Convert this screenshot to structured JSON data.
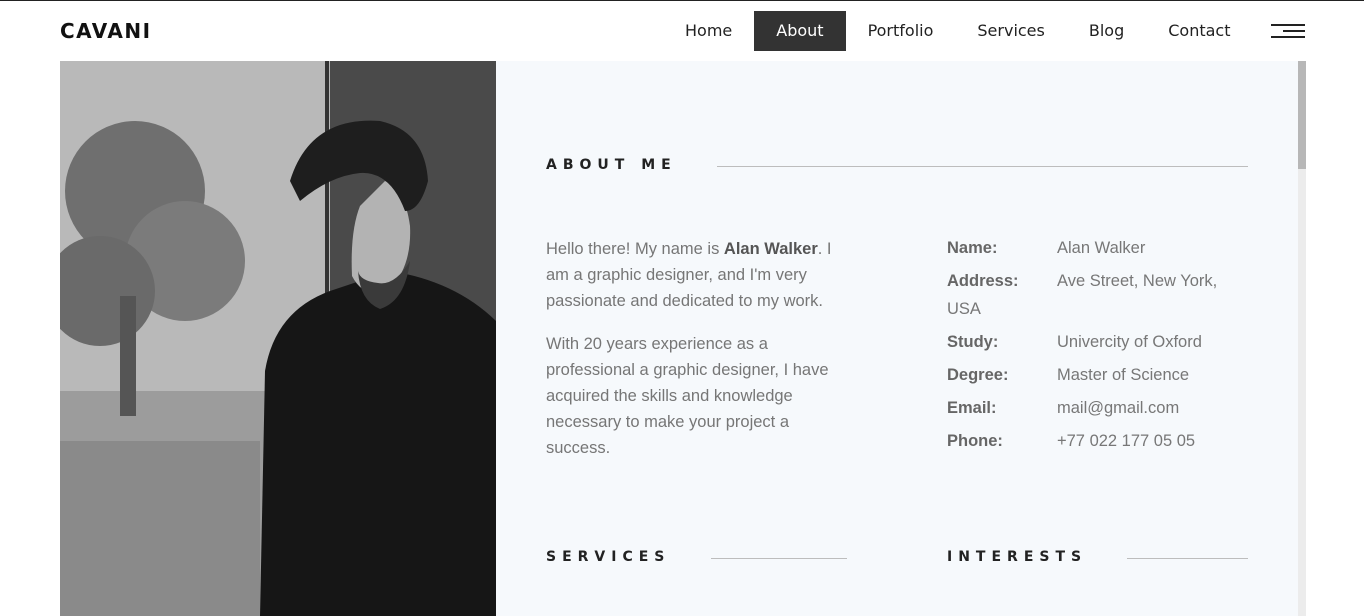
{
  "brand": "CAVANI",
  "nav": [
    "Home",
    "About",
    "Portfolio",
    "Services",
    "Blog",
    "Contact"
  ],
  "nav_active": "About",
  "about": {
    "title": "ABOUT ME",
    "intro_pre": "Hello there! My name is ",
    "intro_name": "Alan Walker",
    "intro_post": ". I am a graphic designer, and I'm very passionate and dedicated to my work.",
    "paragraph2": "With 20 years experience as a professional a graphic designer, I have acquired the skills and knowledge necessary to make your project a success."
  },
  "info": [
    {
      "label": "Name:",
      "value": "Alan Walker"
    },
    {
      "label": "Address:",
      "value": "Ave Street, New York,"
    },
    {
      "label": "",
      "value": "USA"
    },
    {
      "label": "Study:",
      "value": "Univercity of Oxford"
    },
    {
      "label": "Degree:",
      "value": "Master of Science"
    },
    {
      "label": "Email:",
      "value": "mail@gmail.com"
    },
    {
      "label": "Phone:",
      "value": "+77 022 177 05 05"
    }
  ],
  "sections": {
    "services": "SERVICES",
    "interests": "INTERESTS"
  },
  "icons": {
    "menu": "hamburger-menu-icon"
  },
  "colors": {
    "accent": "#333333",
    "panel_bg": "#f6f9fc",
    "text_muted": "#767676"
  }
}
